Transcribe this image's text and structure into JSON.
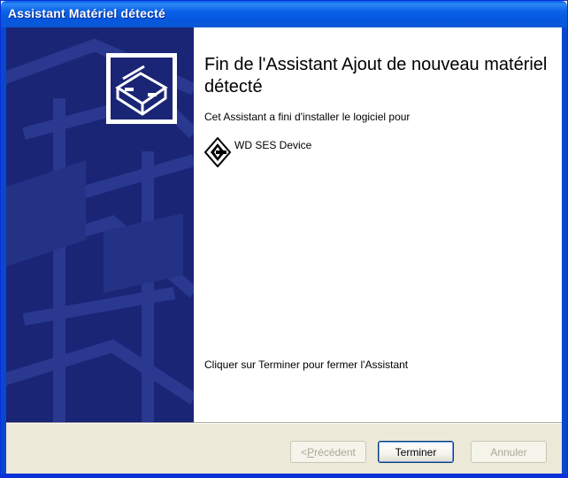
{
  "window": {
    "title": "Assistant Matériel détecté"
  },
  "wizard": {
    "heading": "Fin de l'Assistant Ajout de nouveau matériel détecté",
    "installed_text": "Cet Assistant a fini d'installer le logiciel pour",
    "device_name": "WD SES Device",
    "finish_instruction": "Cliquer sur Terminer pour fermer l'Assistant",
    "icons": {
      "wizard": "hardware-wizard-icon",
      "device": "generic-device-icon"
    }
  },
  "buttons": {
    "prev_prefix": "< ",
    "prev_accel": "P",
    "prev_rest": "récédent",
    "finish": "Terminer",
    "cancel": "Annuler"
  },
  "colors": {
    "titlebar": "#0a5fe8",
    "side_panel": "#1b2576",
    "dialog_bg": "#ece9d8"
  }
}
